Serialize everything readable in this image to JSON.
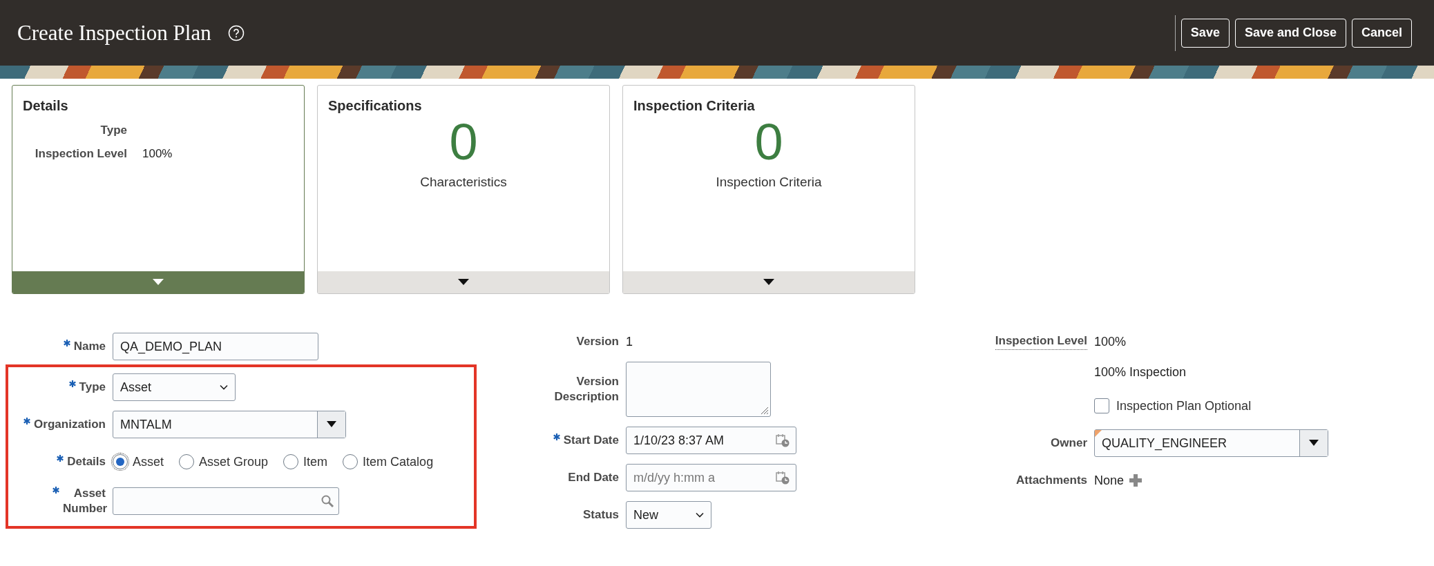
{
  "header": {
    "title": "Create Inspection Plan",
    "buttons": [
      {
        "label": "Save"
      },
      {
        "label": "Save and Close"
      },
      {
        "label": "Cancel"
      }
    ]
  },
  "cards": [
    {
      "title": "Details",
      "kind": "details",
      "selected": true,
      "fields": [
        {
          "label": "Type"
        },
        {
          "label": "Inspection Level",
          "value": "100%"
        }
      ]
    },
    {
      "title": "Specifications",
      "kind": "count",
      "selected": false,
      "count": "0",
      "caption": "Characteristics"
    },
    {
      "title": "Inspection Criteria",
      "kind": "count",
      "selected": false,
      "count": "0",
      "caption": "Inspection Criteria"
    }
  ],
  "form": {
    "columns": [
      {
        "groups": [
          {
            "highlighted": false,
            "fields": [
              {
                "kind": "text",
                "label": "Name",
                "required": true,
                "value": "QA_DEMO_PLAN"
              }
            ]
          },
          {
            "highlighted": true,
            "fields": [
              {
                "kind": "select",
                "label": "Type",
                "required": true,
                "value": "Asset"
              },
              {
                "kind": "combo",
                "label": "Organization",
                "required": true,
                "value": "MNTALM"
              },
              {
                "kind": "radio",
                "label": "Details",
                "required": true,
                "options": [
                  {
                    "label": "Asset",
                    "selected": true
                  },
                  {
                    "label": "Asset Group",
                    "selected": false
                  },
                  {
                    "label": "Item",
                    "selected": false
                  },
                  {
                    "label": "Item Catalog",
                    "selected": false
                  }
                ]
              },
              {
                "kind": "search",
                "label": "Asset Number",
                "required": true
              }
            ]
          }
        ]
      },
      {
        "groups": [
          {
            "highlighted": false,
            "fields": [
              {
                "kind": "display",
                "label": "Version",
                "value": "1"
              },
              {
                "kind": "textarea",
                "label": "Version Description"
              },
              {
                "kind": "date",
                "label": "Start Date",
                "required": true,
                "value": "1/10/23 8:37 AM"
              },
              {
                "kind": "date",
                "label": "End Date",
                "placeholder": "m/d/yy h:mm a"
              },
              {
                "kind": "select",
                "label": "Status",
                "value": "New"
              }
            ]
          }
        ]
      },
      {
        "groups": [
          {
            "highlighted": false,
            "fields": [
              {
                "kind": "display",
                "label": "Inspection Level",
                "hint": true,
                "value": "100%"
              },
              {
                "kind": "note",
                "value": "100% Inspection"
              },
              {
                "kind": "checkbox",
                "label": "Inspection Plan Optional",
                "checked": false
              },
              {
                "kind": "combo",
                "label": "Owner",
                "modified": true,
                "value": "QUALITY_ENGINEER"
              },
              {
                "kind": "attachments",
                "label": "Attachments",
                "value": "None"
              }
            ]
          }
        ]
      }
    ]
  }
}
